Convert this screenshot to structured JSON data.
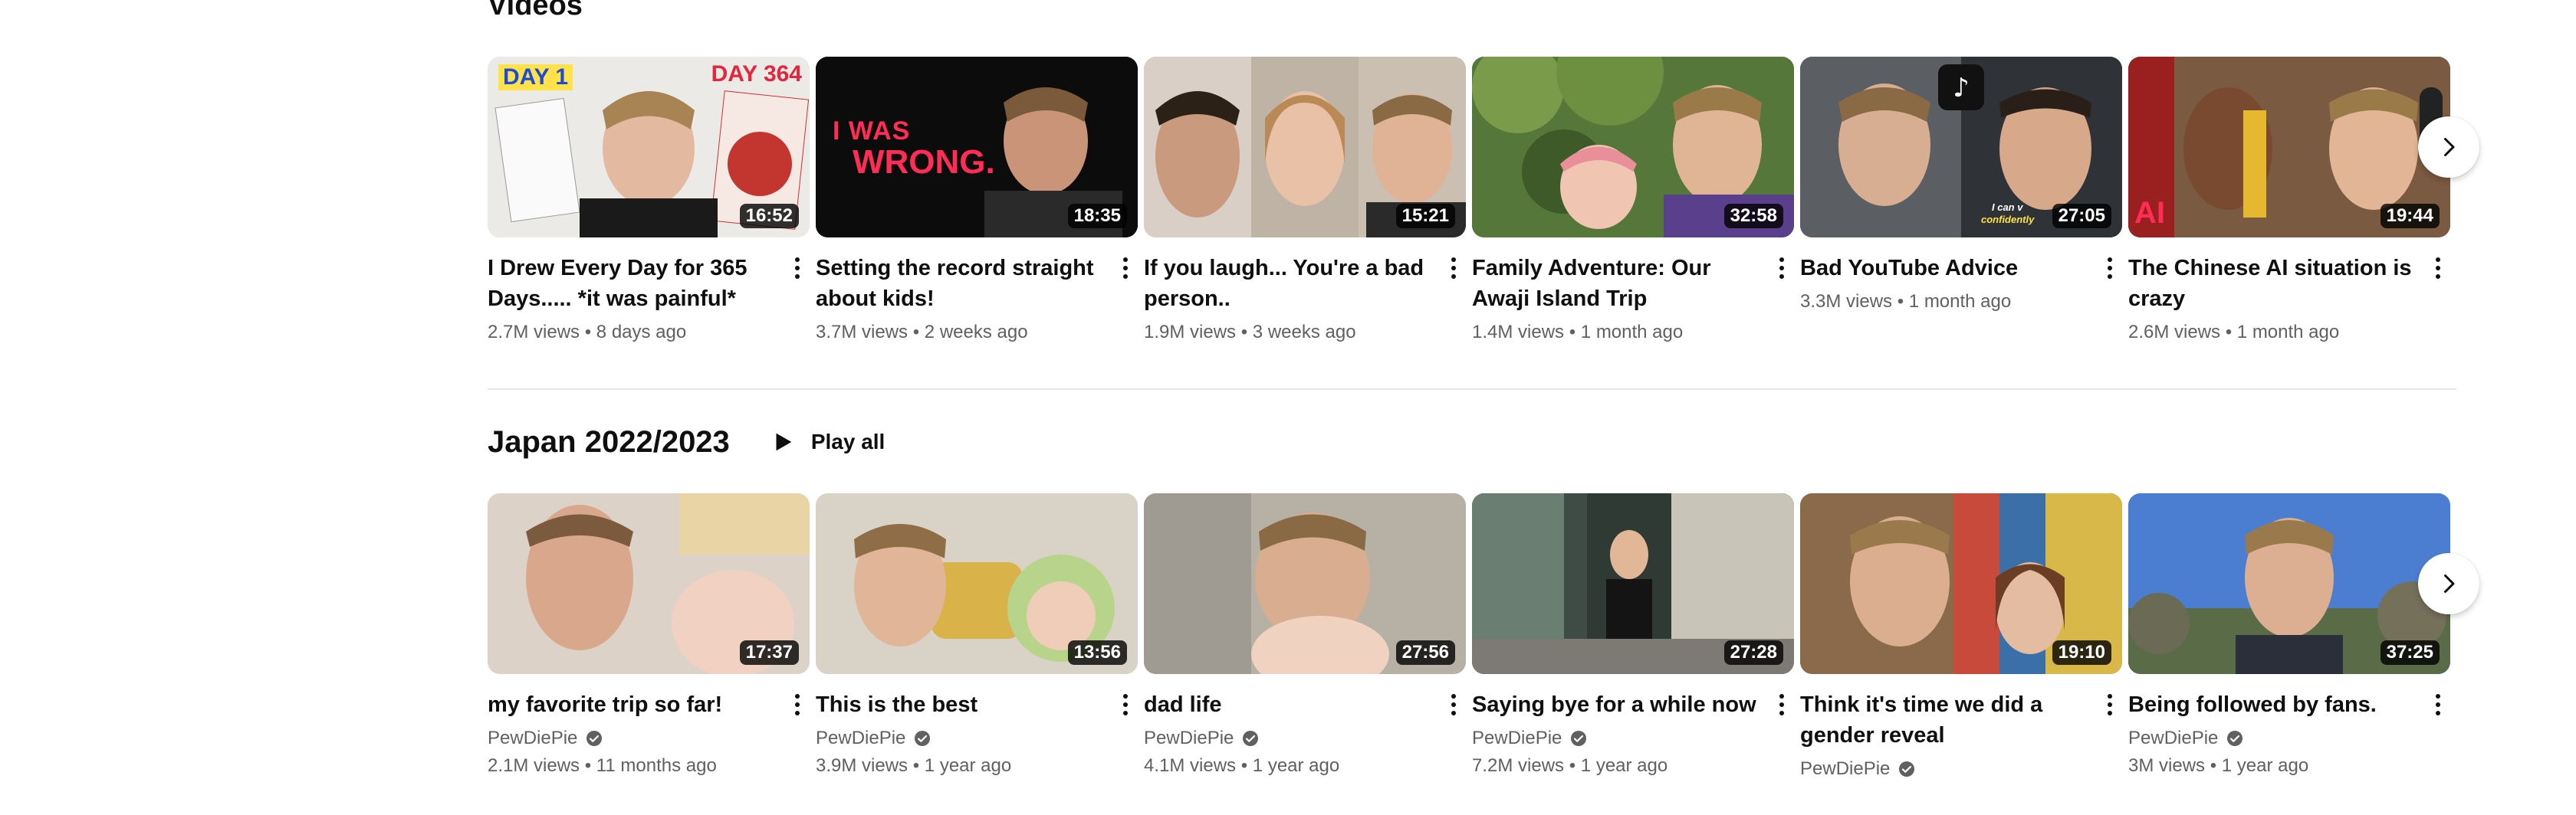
{
  "sections": {
    "videos_title": "Videos",
    "japan_title": "Japan 2022/2023",
    "play_all_label": "Play all"
  },
  "videos": [
    {
      "title": "I Drew Every Day for 365 Days..... *it was painful*",
      "duration": "16:52",
      "views": "2.7M views",
      "age": "8 days ago",
      "overlay": [
        "DAY 1",
        "DAY 364"
      ]
    },
    {
      "title": "Setting the record straight about kids!",
      "duration": "18:35",
      "views": "3.7M views",
      "age": "2 weeks ago",
      "overlay": [
        "I WAS",
        "WRONG."
      ]
    },
    {
      "title": "If you laugh... You're a bad person..",
      "duration": "15:21",
      "views": "1.9M views",
      "age": "3 weeks ago"
    },
    {
      "title": "Family Adventure: Our Awaji Island Trip",
      "duration": "32:58",
      "views": "1.4M views",
      "age": "1 month ago"
    },
    {
      "title": "Bad YouTube Advice",
      "duration": "27:05",
      "views": "3.3M views",
      "age": "1 month ago",
      "overlay": [
        "I can v",
        "confidently"
      ]
    },
    {
      "title": "The Chinese AI situation is crazy",
      "duration": "19:44",
      "views": "2.6M views",
      "age": "1 month ago",
      "overlay": [
        "AI"
      ]
    }
  ],
  "japan": [
    {
      "title": "my favorite trip so far!",
      "duration": "17:37",
      "channel": "PewDiePie",
      "views": "2.1M views",
      "age": "11 months ago"
    },
    {
      "title": "This is the best",
      "duration": "13:56",
      "channel": "PewDiePie",
      "views": "3.9M views",
      "age": "1 year ago"
    },
    {
      "title": "dad life",
      "duration": "27:56",
      "channel": "PewDiePie",
      "views": "4.1M views",
      "age": "1 year ago"
    },
    {
      "title": "Saying bye for a while now",
      "duration": "27:28",
      "channel": "PewDiePie",
      "views": "7.2M views",
      "age": "1 year ago"
    },
    {
      "title": "Think it's time we did a gender reveal",
      "duration": "19:10",
      "channel": "PewDiePie",
      "views": "",
      "age": ""
    },
    {
      "title": "Being followed by fans.",
      "duration": "37:25",
      "channel": "PewDiePie",
      "views": "3M views",
      "age": "1 year ago"
    }
  ],
  "icons": {
    "play": "play-icon",
    "next": "chevron-right-icon",
    "more": "more-vert-icon",
    "verified": "verified-check-icon"
  },
  "colors": {
    "text_primary": "#0f0f0f",
    "text_secondary": "#606060",
    "duration_bg": "#000000cc",
    "wrong_red": "#ff2d55"
  }
}
